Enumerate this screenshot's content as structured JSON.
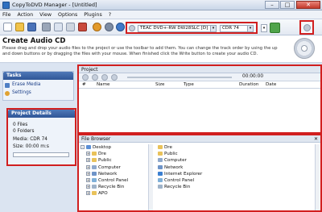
{
  "window": {
    "title": "CopyToDVD Manager - [Untitled]",
    "minimize": "–",
    "maximize": "□",
    "close": "✕"
  },
  "menu": [
    "File",
    "Action",
    "View",
    "Options",
    "Plugins",
    "?"
  ],
  "toolbar": {
    "icons": [
      "new-icon",
      "open-icon",
      "save-icon",
      "cut-icon",
      "copy-icon",
      "delete-icon",
      "burn-icon",
      "settings-icon",
      "help-icon"
    ],
    "drive": "TEAC     DVD+-RW DW28SLC [D]",
    "media": "CDR 74",
    "colors": {
      "accent": "#2f5697",
      "highlight": "#d11f1f"
    }
  },
  "header": {
    "title": "Create Audio CD",
    "description": "Please drag and drop your audio files to the project or use the toolbar to add them. You can change the track order by using the up and down buttons or by dragging the files with your mouse. When finished click the Write button to create your audio CD."
  },
  "tasks": {
    "title": "Tasks",
    "items": [
      "Erase Media",
      "Settings"
    ]
  },
  "project_details": {
    "title": "Project Details",
    "files": "0 Files",
    "folders": "0 Folders",
    "media": "Media: CDR 74",
    "size": "Size: 00:00 m:s"
  },
  "project": {
    "title": "Project",
    "time": "00:00:00",
    "columns": [
      "#",
      "Name",
      "Size",
      "Type",
      "Duration",
      "Date"
    ]
  },
  "file_browser": {
    "title": "File Browser",
    "close": "✕",
    "tree": [
      "Desktop",
      "Dre",
      "Public",
      "Computer",
      "Network",
      "Control Panel",
      "Recycle Bin",
      "APO"
    ],
    "list": [
      "Dre",
      "Public",
      "Computer",
      "Network",
      "Internet Explorer",
      "Control Panel",
      "Recycle Bin"
    ]
  }
}
